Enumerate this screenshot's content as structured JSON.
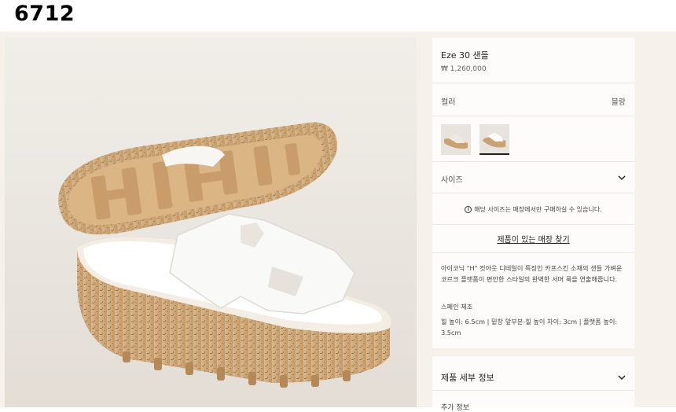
{
  "header": {
    "product_code": "6712"
  },
  "product": {
    "title": "Eze 30 샌들",
    "price": "₩ 1,260,000"
  },
  "color": {
    "label": "컬러",
    "value": "블랑"
  },
  "swatches": [
    {
      "name": "sandal-variant-1",
      "selected": false
    },
    {
      "name": "sandal-variant-2",
      "selected": true
    }
  ],
  "size": {
    "label": "사이즈",
    "icon": "chevron-down-icon"
  },
  "availability": {
    "notice": "해당 사이즈는 매장에서만 구매하실 수 있습니다.",
    "icon": "info-icon",
    "store_link": "제품이 있는 매장 찾기"
  },
  "description": {
    "text": "아이코닉 \"H\" 컷아웃 디테일이 특징인 카프스킨 소재의 샌들 가벼운 코르크 플랫폼이 편안한 스타일의 완벽한 서머 룩을 연출해줍니다.",
    "made_in": "스페인 제조",
    "dimensions": "힐 높이: 6.5cm | 밑창 앞부분-힐 높이 차이: 3cm | 플랫폼 높이: 3.5cm"
  },
  "details": {
    "title": "제품 세부 정보",
    "next_label": "추가 정보"
  },
  "colors": {
    "accent": "#222222",
    "background": "#f6f1eb",
    "card": "#fdfcfa",
    "cork": "#c9a273"
  }
}
